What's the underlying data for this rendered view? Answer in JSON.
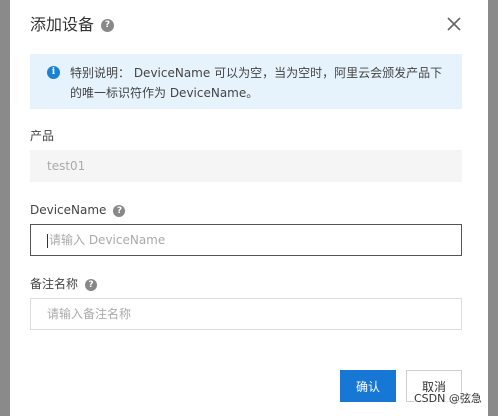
{
  "dialog": {
    "title": "添加设备",
    "notice": "特别说明： DeviceName 可以为空，当为空时，阿里云会颁发产品下的唯一标识符作为 DeviceName。",
    "product": {
      "label": "产品",
      "value": "test01"
    },
    "device_name": {
      "label": "DeviceName",
      "placeholder": "请输入 DeviceName"
    },
    "remark": {
      "label": "备注名称",
      "placeholder": "请输入备注名称"
    },
    "confirm_label": "确认",
    "cancel_label": "取消",
    "help_glyph": "?",
    "info_glyph": "i"
  },
  "watermark": "CSDN @弦急",
  "colors": {
    "primary": "#1677d4",
    "notice_bg": "#e6f3fd",
    "info_icon": "#1a82d6",
    "overlay": "#8a8a8a"
  },
  "icons": {
    "title_help": "question-circle-icon",
    "close": "close-icon",
    "notice": "info-circle-icon"
  }
}
